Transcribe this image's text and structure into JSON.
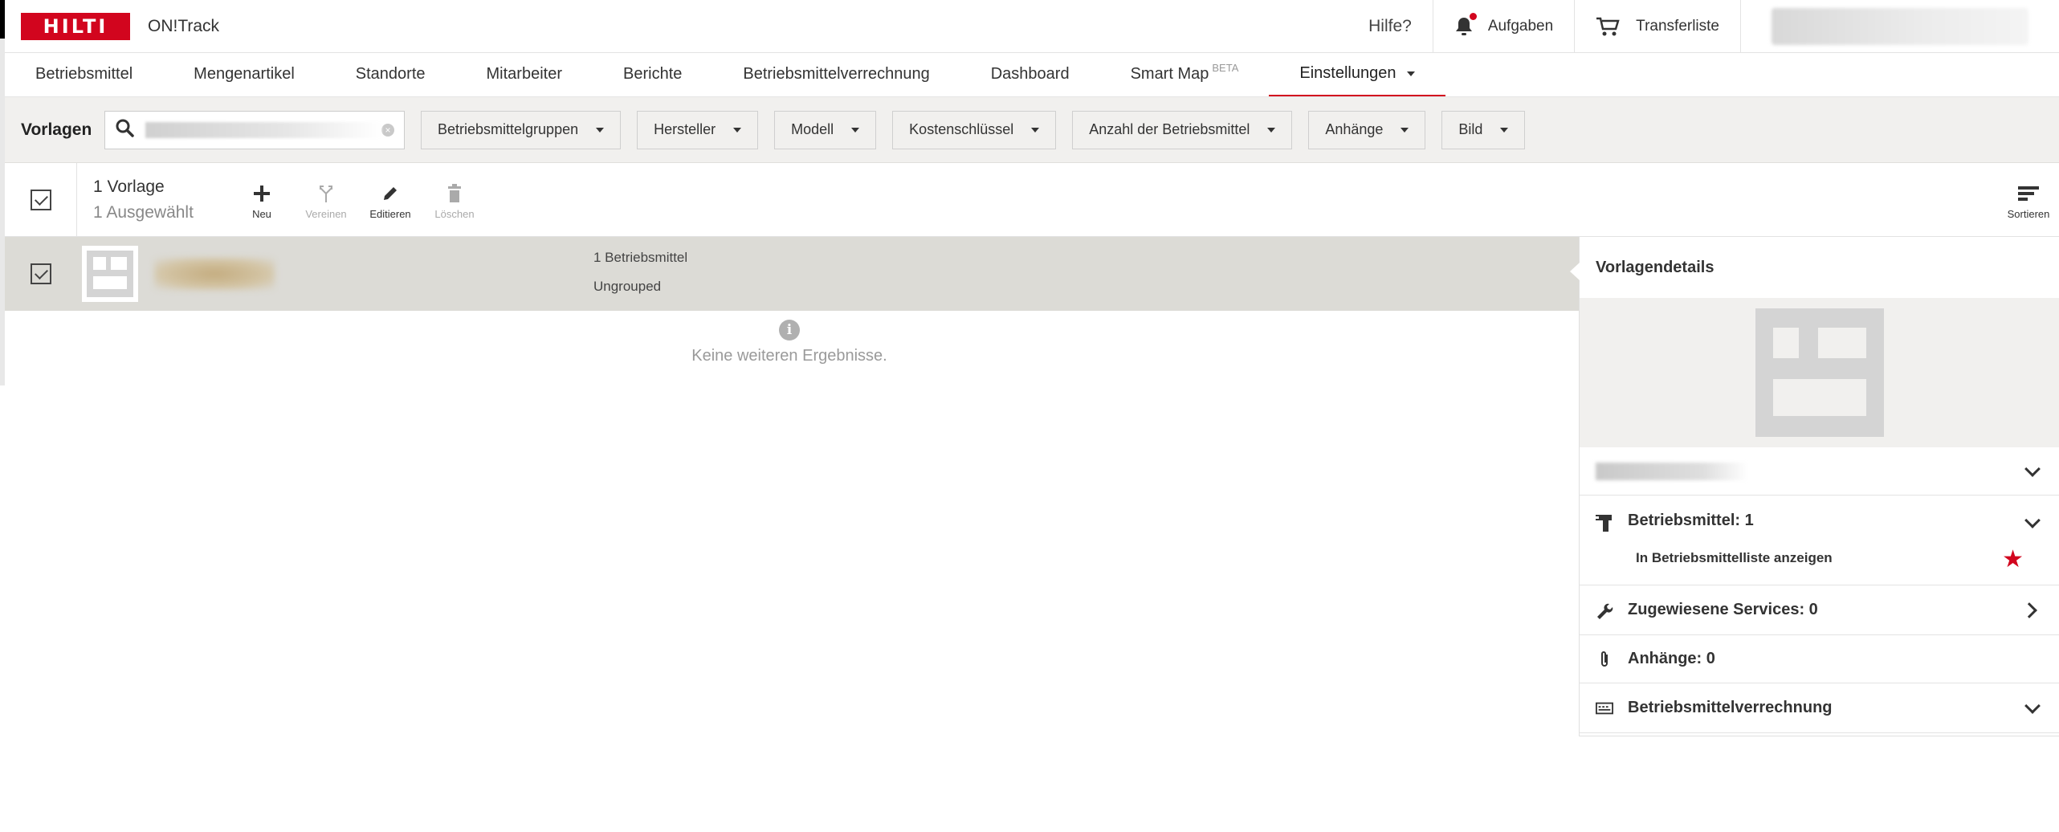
{
  "brand": {
    "logo_text": "HILTI",
    "app_name": "ON!Track",
    "accent": "#d2051e"
  },
  "topbar": {
    "help": "Hilfe?",
    "tasks": "Aufgaben",
    "transfer": "Transferliste"
  },
  "nav": {
    "items": [
      "Betriebsmittel",
      "Mengenartikel",
      "Standorte",
      "Mitarbeiter",
      "Berichte",
      "Betriebsmittelverrechnung",
      "Dashboard",
      "Smart Map",
      "Einstellungen"
    ],
    "beta_label": "BETA"
  },
  "filters": {
    "title": "Vorlagen",
    "buttons": [
      "Betriebsmittelgruppen",
      "Hersteller",
      "Modell",
      "Kostenschlüssel",
      "Anzahl der Betriebsmittel",
      "Anhänge",
      "Bild"
    ]
  },
  "toolbar": {
    "count_label": "1 Vorlage",
    "selected_label": "1 Ausgewählt",
    "new": "Neu",
    "merge": "Vereinen",
    "edit": "Editieren",
    "delete": "Löschen",
    "sort": "Sortieren"
  },
  "list": {
    "row": {
      "assets": "1 Betriebsmittel",
      "group": "Ungrouped"
    },
    "no_more": "Keine weiteren Ergebnisse."
  },
  "details": {
    "title": "Vorlagendetails",
    "assets_label": "Betriebsmittel: 1",
    "show_in_list": "In Betriebsmittelliste anzeigen",
    "services_label": "Zugewiesene Services: 0",
    "attachments_label": "Anhänge: 0",
    "billing_label": "Betriebsmittelverrechnung"
  }
}
